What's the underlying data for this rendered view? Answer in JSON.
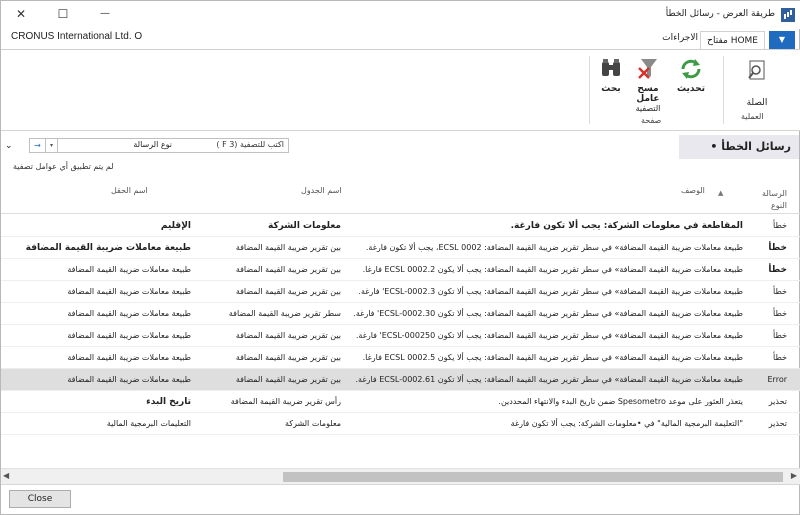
{
  "window": {
    "title": "طريقة العرض - رسائل الخطأ",
    "close_glyph": "✕",
    "maximize_glyph": "☐",
    "minimize_glyph": "—"
  },
  "company": "CRONUS International Ltd. O",
  "ribbon": {
    "menu_glyph": "▼",
    "tab_home": "مفتاح HOME",
    "tab_actions": "الاجراءات",
    "buttons": {
      "search": "بحث",
      "clear_filter": "مسح عامل",
      "clear_filter_sub": "التصفية",
      "refresh": "تحديث",
      "link": "الصلة"
    },
    "groups": {
      "page": "صفحة",
      "process": "العملية"
    }
  },
  "page_title": "رسائل الخطأ •",
  "collapse_glyph": "⌄",
  "filter": {
    "arrow": "→",
    "dropdown": "▾",
    "field": "نوع الرسالة",
    "hint": "اكتب للتصفية (F 3 )"
  },
  "no_filter_text": "لم يتم تطبيق أي عوامل تصفية",
  "columns": {
    "type": "الرسالة النوع",
    "description": "الوصف",
    "table_name": "اسم الجدول",
    "field_name": "اسم الحقل"
  },
  "rows": [
    {
      "type": "خطأ",
      "description": "المقاطعة في معلومات الشركة: يجب ألا تكون فارغة.",
      "table": "معلومات الشركة",
      "field": "الإقليم",
      "bold": true
    },
    {
      "type": "خطأ",
      "description": "طبيعة معاملات ضريبة القيمة المضافة» في سطر تقرير ضريبة القيمة المضافة: 0002 ECSL، يجب ألا تكون فارغة.",
      "table": "بين تقرير ضريبة القيمة المضافة",
      "field": "طبيعة معاملات ضريبة القيمة المضافة",
      "bold_type": true,
      "bold_field": true
    },
    {
      "type": "خطأ",
      "description": "طبيعة معاملات ضريبة القيمة المضافة» في سطر تقرير ضريبة القيمة المضافة: يجب ألا يكون 0002.2 ECSL فارغا.",
      "table": "بين تقرير ضريبة القيمة المضافة",
      "field": "طبيعة معاملات ضريبة القيمة المضافة",
      "bold_type": true
    },
    {
      "type": "خطأ",
      "description": "طبيعة معاملات ضريبة القيمة المضافة» في سطر تقرير ضريبة القيمة المضافة: يجب ألا تكون ECSL-0002.3' فارغة.",
      "table": "بين تقرير ضريبة القيمة المضافة",
      "field": "طبيعة معاملات ضريبة القيمة المضافة"
    },
    {
      "type": "خطأ",
      "description": "طبيعة معاملات ضريبة القيمة المضافة» في سطر تقرير ضريبة القيمة المضافة: يجب ألا تكون ECSL-0002.30' فارغة.",
      "table": "سطر تقرير ضريبة القيمة المضافة",
      "field": "طبيعة معاملات ضريبة القيمة المضافة"
    },
    {
      "type": "خطأ",
      "description": "طبيعة معاملات ضريبة القيمة المضافة» في سطر تقرير ضريبة القيمة المضافة: يجب ألا تكون ECSL-000250' فارغة.",
      "table": "بين تقرير ضريبة القيمة المضافة",
      "field": "طبيعة معاملات ضريبة القيمة المضافة"
    },
    {
      "type": "خطأ",
      "description": "طبيعة معاملات ضريبة القيمة المضافة» في سطر تقرير ضريبة القيمة المضافة: يجب ألا يكون 0002.5 ECSL فارغا.",
      "table": "بين تقرير ضريبة القيمة المضافة",
      "field": "طبيعة معاملات ضريبة القيمة المضافة"
    },
    {
      "type": "Error",
      "description": "طبيعة معاملات ضريبة القيمة المضافة» في سطر تقرير ضريبة القيمة المضافة: يجب ألا تكون ECSL-0002.61 فارغة.",
      "table": "بين تقرير ضريبة القيمة المضافة",
      "field": "طبيعة معاملات ضريبة القيمة المضافة",
      "selected": true
    },
    {
      "type": "تحذير",
      "description": "يتعذر العثور على موعد Spesometro ضمن تاريخ البدء والانتهاء المحددين.",
      "table": "رأس تقرير ضريبة القيمة المضافة",
      "field": "تاريخ البدء",
      "bold_field": true
    },
    {
      "type": "تحذير",
      "description": "\"التعليمة البرمجية المالية\" في •معلومات الشركة: يجب ألا تكون فارغة",
      "table": "معلومات الشركة",
      "field": "التعليمات البرمجية المالية"
    }
  ],
  "scroll": {
    "left": "◀",
    "right": "▶"
  },
  "close_button": "Close"
}
